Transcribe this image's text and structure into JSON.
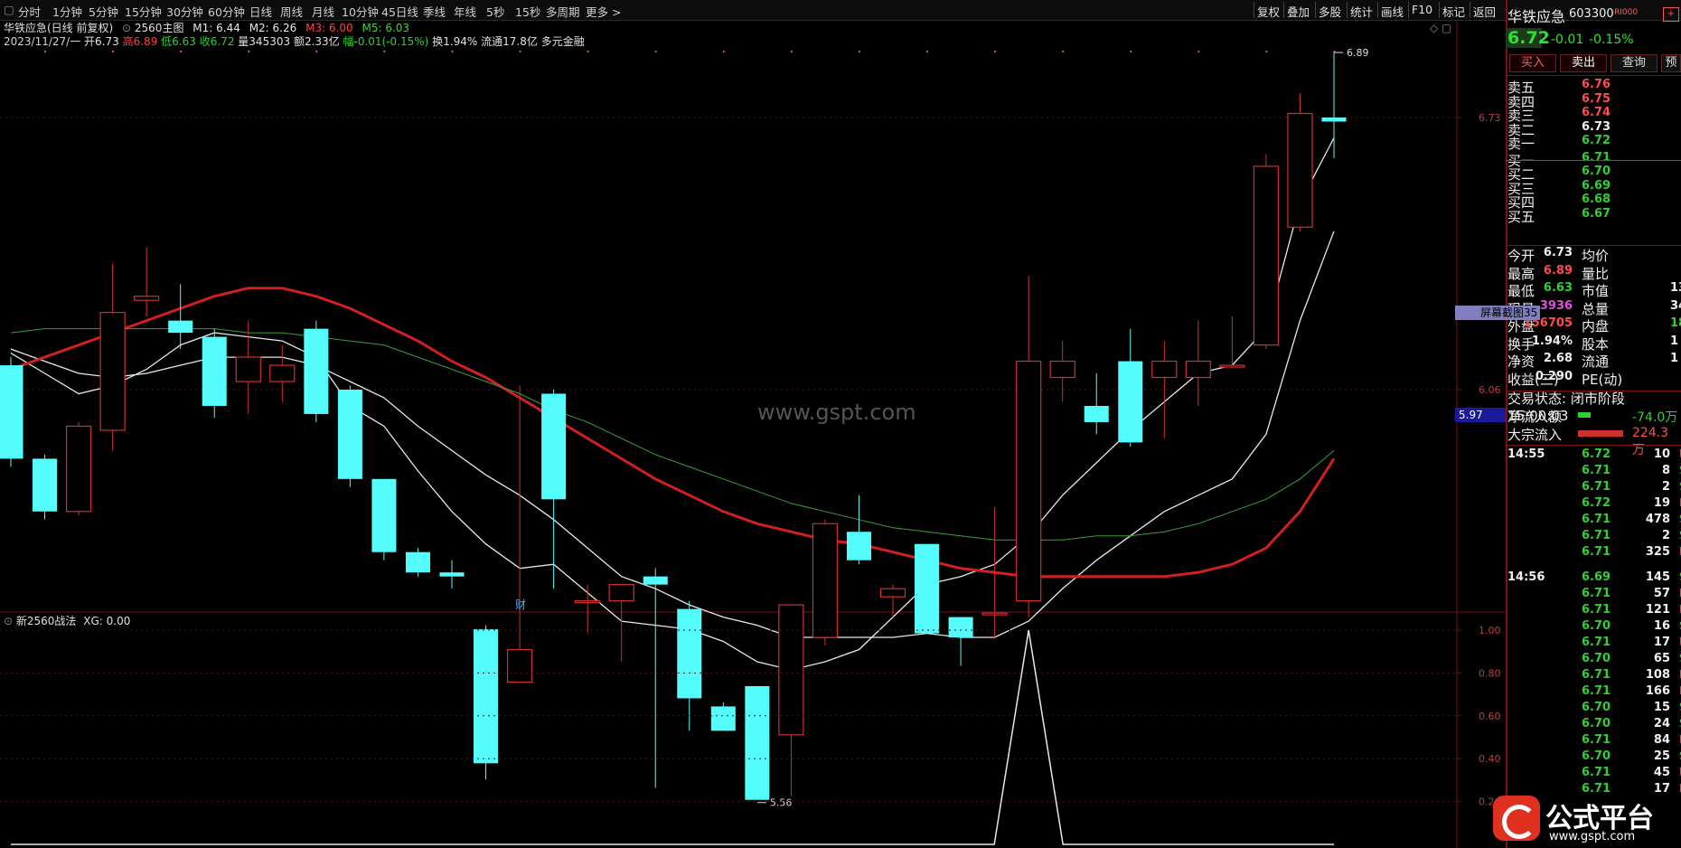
{
  "toolbar": {
    "periods": [
      "分时",
      "1分钟",
      "5分钟",
      "15分钟",
      "30分钟",
      "60分钟",
      "日线",
      "周线",
      "月线",
      "10分钟",
      "45日线",
      "季线",
      "年线",
      "5秒",
      "15秒",
      "多周期",
      "更多 >"
    ],
    "actions": [
      "复权",
      "叠加",
      "多股",
      "统计",
      "画线",
      "F10",
      "标记",
      "返回"
    ]
  },
  "chart_header": {
    "line1": {
      "stock": "华铁应急(日线 前复权)",
      "indicator": "2560主图",
      "m1": "M1: 6.44",
      "m2": "M2: 6.26",
      "m3": "M3: 6.00",
      "m5": "M5: 6.03"
    },
    "line2": {
      "date": "2023/11/27/一",
      "open": "开6.73",
      "high": "高6.89",
      "low": "低6.63",
      "close": "收6.72",
      "volume": "量345303",
      "amount": "额2.33亿",
      "change": "幅-0.01(-0.15%)",
      "turnover": "换1.94%",
      "float": "流通17.8亿",
      "tag": "多元金融"
    },
    "watermark": "www.gspt.com",
    "fin_mark": "财"
  },
  "sub_chart": {
    "title": "新2560战法",
    "value": "XG: 0.00"
  },
  "chart_data": {
    "type": "candlestick",
    "title": "华铁应急(日线 前复权)",
    "candles": [
      {
        "o": 6.12,
        "h": 6.14,
        "l": 5.87,
        "c": 5.89
      },
      {
        "o": 5.89,
        "h": 5.9,
        "l": 5.74,
        "c": 5.76
      },
      {
        "o": 5.76,
        "h": 5.98,
        "l": 5.75,
        "c": 5.97
      },
      {
        "o": 5.96,
        "h": 6.37,
        "l": 5.91,
        "c": 6.25
      },
      {
        "o": 6.28,
        "h": 6.41,
        "l": 6.24,
        "c": 6.29
      },
      {
        "o": 6.23,
        "h": 6.32,
        "l": 6.16,
        "c": 6.2
      },
      {
        "o": 6.19,
        "h": 6.21,
        "l": 5.99,
        "c": 6.02
      },
      {
        "o": 6.08,
        "h": 6.23,
        "l": 6.0,
        "c": 6.14
      },
      {
        "o": 6.08,
        "h": 6.17,
        "l": 6.03,
        "c": 6.12
      },
      {
        "o": 6.21,
        "h": 6.23,
        "l": 5.98,
        "c": 6.0
      },
      {
        "o": 6.06,
        "h": 6.07,
        "l": 5.82,
        "c": 5.84
      },
      {
        "o": 5.84,
        "h": 5.84,
        "l": 5.64,
        "c": 5.66
      },
      {
        "o": 5.66,
        "h": 5.67,
        "l": 5.6,
        "c": 5.61
      },
      {
        "o": 5.61,
        "h": 5.64,
        "l": 5.57,
        "c": 5.6
      },
      {
        "o": 5.47,
        "h": 5.48,
        "l": 5.1,
        "c": 5.14
      },
      {
        "o": 5.34,
        "h": 6.07,
        "l": 5.34,
        "c": 5.42
      },
      {
        "o": 6.05,
        "h": 6.06,
        "l": 5.57,
        "c": 5.79
      },
      {
        "o": 5.54,
        "h": 5.58,
        "l": 5.46,
        "c": 5.54
      },
      {
        "o": 5.54,
        "h": 5.55,
        "l": 5.39,
        "c": 5.58
      },
      {
        "o": 5.6,
        "h": 5.62,
        "l": 5.08,
        "c": 5.58
      },
      {
        "o": 5.52,
        "h": 5.54,
        "l": 5.22,
        "c": 5.3
      },
      {
        "o": 5.28,
        "h": 5.29,
        "l": 5.22,
        "c": 5.22
      },
      {
        "o": 5.33,
        "h": 5.33,
        "l": 5.05,
        "c": 5.05
      },
      {
        "o": 5.21,
        "h": 5.53,
        "l": 5.06,
        "c": 5.53
      },
      {
        "o": 5.45,
        "h": 5.74,
        "l": 5.43,
        "c": 5.73
      },
      {
        "o": 5.71,
        "h": 5.8,
        "l": 5.63,
        "c": 5.64
      },
      {
        "o": 5.55,
        "h": 5.58,
        "l": 5.5,
        "c": 5.57
      },
      {
        "o": 5.68,
        "h": 5.68,
        "l": 5.46,
        "c": 5.46
      },
      {
        "o": 5.5,
        "h": 5.5,
        "l": 5.38,
        "c": 5.45
      },
      {
        "o": 5.51,
        "h": 5.77,
        "l": 5.45,
        "c": 5.51
      },
      {
        "o": 5.54,
        "h": 6.34,
        "l": 5.5,
        "c": 6.13
      },
      {
        "o": 6.09,
        "h": 6.18,
        "l": 6.03,
        "c": 6.13
      },
      {
        "o": 6.02,
        "h": 6.1,
        "l": 5.95,
        "c": 5.98
      },
      {
        "o": 6.13,
        "h": 6.21,
        "l": 5.92,
        "c": 5.93
      },
      {
        "o": 6.09,
        "h": 6.18,
        "l": 5.94,
        "c": 6.13
      },
      {
        "o": 6.09,
        "h": 6.23,
        "l": 6.02,
        "c": 6.13
      },
      {
        "o": 6.12,
        "h": 6.24,
        "l": 6.12,
        "c": 6.12
      },
      {
        "o": 6.17,
        "h": 6.64,
        "l": 6.16,
        "c": 6.61
      },
      {
        "o": 6.46,
        "h": 6.79,
        "l": 6.45,
        "c": 6.74
      },
      {
        "o": 6.73,
        "h": 6.89,
        "l": 6.63,
        "c": 6.72
      }
    ],
    "ma_series": [
      {
        "name": "M1",
        "color": "#e8e8e8",
        "width": 1.3,
        "values": [
          6.15,
          6.1,
          6.05,
          6.07,
          6.11,
          6.17,
          6.2,
          6.19,
          6.18,
          6.14,
          6.02,
          5.97,
          5.86,
          5.76,
          5.68,
          5.62,
          5.63,
          5.56,
          5.49,
          5.48,
          5.47,
          5.44,
          5.39,
          5.37,
          5.39,
          5.42,
          5.5,
          5.58,
          5.6,
          5.63,
          5.7,
          5.8,
          5.88,
          5.96,
          6.03,
          6.1,
          6.12,
          6.21,
          6.52,
          6.68
        ]
      },
      {
        "name": "M2",
        "color": "#e8e8e8",
        "width": 1.3,
        "values": [
          6.16,
          6.13,
          6.1,
          6.09,
          6.1,
          6.12,
          6.14,
          6.14,
          6.14,
          6.12,
          6.08,
          6.04,
          5.97,
          5.91,
          5.85,
          5.8,
          5.74,
          5.67,
          5.6,
          5.57,
          5.53,
          5.5,
          5.48,
          5.45,
          5.45,
          5.45,
          5.45,
          5.46,
          5.45,
          5.45,
          5.49,
          5.57,
          5.64,
          5.7,
          5.76,
          5.8,
          5.84,
          5.95,
          6.23,
          6.45
        ]
      },
      {
        "name": "M3",
        "color": "#d02020",
        "width": 3,
        "values": [
          6.11,
          6.14,
          6.17,
          6.2,
          6.23,
          6.26,
          6.29,
          6.31,
          6.31,
          6.29,
          6.26,
          6.22,
          6.18,
          6.13,
          6.09,
          6.04,
          5.99,
          5.94,
          5.89,
          5.84,
          5.8,
          5.76,
          5.73,
          5.71,
          5.69,
          5.68,
          5.66,
          5.64,
          5.62,
          5.61,
          5.6,
          5.6,
          5.6,
          5.6,
          5.6,
          5.61,
          5.63,
          5.67,
          5.76,
          5.89
        ]
      },
      {
        "name": "M5",
        "color": "#3aa03a",
        "width": 1,
        "values": [
          6.2,
          6.21,
          6.21,
          6.21,
          6.21,
          6.21,
          6.21,
          6.2,
          6.2,
          6.19,
          6.18,
          6.17,
          6.14,
          6.11,
          6.08,
          6.05,
          6.01,
          5.98,
          5.94,
          5.9,
          5.87,
          5.84,
          5.81,
          5.78,
          5.76,
          5.74,
          5.72,
          5.71,
          5.7,
          5.69,
          5.69,
          5.69,
          5.7,
          5.7,
          5.71,
          5.73,
          5.76,
          5.79,
          5.84,
          5.91
        ]
      }
    ],
    "annotations": {
      "high_label": "6.89",
      "low_label": "5.56"
    },
    "ylabels": [
      "6.73",
      "6.06"
    ],
    "current_price_tag": "5.97",
    "sub_values": [
      0,
      0,
      0,
      0,
      0,
      0,
      0,
      0,
      0,
      0,
      0,
      0,
      0,
      0,
      0,
      0,
      0,
      0,
      0,
      0,
      0,
      0,
      0,
      0,
      0,
      0,
      0,
      0,
      0,
      0,
      1,
      0,
      0,
      0,
      0,
      0,
      0,
      0,
      0,
      0
    ],
    "sub_ylabels": [
      "1.00",
      "0.80",
      "0.60",
      "0.40",
      "0.2"
    ],
    "sub_ylim": [
      0,
      1
    ]
  },
  "quote": {
    "name": "华铁应急",
    "code": "603300",
    "badge": "R\u0000",
    "price": "6.72",
    "change": "-0.01",
    "change_pct": "-0.15%",
    "buttons": [
      "买入",
      "卖出",
      "查询",
      "预"
    ],
    "asks": [
      {
        "label": "卖五",
        "price": "6.76",
        "color": "red"
      },
      {
        "label": "卖四",
        "price": "6.75",
        "color": "red"
      },
      {
        "label": "卖三",
        "price": "6.74",
        "color": "red"
      },
      {
        "label": "卖二",
        "price": "6.73",
        "color": "white"
      },
      {
        "label": "卖一",
        "price": "6.72",
        "color": "green"
      }
    ],
    "bids": [
      {
        "label": "买一",
        "price": "6.71",
        "color": "green"
      },
      {
        "label": "买二",
        "price": "6.70",
        "color": "green"
      },
      {
        "label": "买三",
        "price": "6.69",
        "color": "green"
      },
      {
        "label": "买四",
        "price": "6.68",
        "color": "green"
      },
      {
        "label": "买五",
        "price": "6.67",
        "color": "green"
      }
    ],
    "stats": [
      {
        "l1": "今开",
        "v1": "6.73",
        "c1": "white",
        "l2": "均价",
        "v2": "",
        "c2": "white"
      },
      {
        "l1": "最高",
        "v1": "6.89",
        "c1": "red",
        "l2": "量比",
        "v2": "",
        "c2": "white"
      },
      {
        "l1": "最低",
        "v1": "6.63",
        "c1": "green",
        "l2": "市值",
        "v2": "13",
        "c2": "white"
      },
      {
        "l1": "现量",
        "v1": "3936",
        "c1": "mag",
        "l2": "总量",
        "v2": "34",
        "c2": "white"
      },
      {
        "l1": "外盘",
        "v1": "156705",
        "c1": "red",
        "l2": "内盘",
        "v2": "18",
        "c2": "green"
      },
      {
        "l1": "换手",
        "v1": "1.94%",
        "c1": "white",
        "l2": "股本",
        "v2": "1",
        "c2": "white"
      },
      {
        "l1": "净资",
        "v1": "2.68",
        "c1": "white",
        "l2": "流通",
        "v2": "1",
        "c2": "white"
      },
      {
        "l1": "收益(三)",
        "v1": "0.290",
        "c1": "white",
        "l2": "PE(动)",
        "v2": "",
        "c2": "white"
      }
    ],
    "trade_status": "交易状态: 闭市阶段 15:00:03",
    "net_inflow_label": "净流入额",
    "net_inflow": "-74.0万",
    "block_inflow_label": "大宗流入",
    "block_inflow": "224.3万",
    "overlay_tag": "屏幕截图",
    "overlay_num": "35"
  },
  "ticks": [
    {
      "time": "14:55",
      "price": "6.72",
      "vol": "10",
      "dir": "B"
    },
    {
      "time": "",
      "price": "6.71",
      "vol": "8",
      "dir": "S"
    },
    {
      "time": "",
      "price": "6.71",
      "vol": "2",
      "dir": "S"
    },
    {
      "time": "",
      "price": "6.72",
      "vol": "19",
      "dir": "B"
    },
    {
      "time": "",
      "price": "6.71",
      "vol": "478",
      "dir": "S"
    },
    {
      "time": "",
      "price": "6.71",
      "vol": "2",
      "dir": "S"
    },
    {
      "time": "",
      "price": "6.71",
      "vol": "325",
      "dir": "B"
    },
    {
      "time": "14:56",
      "price": "6.69",
      "vol": "145",
      "dir": "S"
    },
    {
      "time": "",
      "price": "6.71",
      "vol": "57",
      "dir": "B"
    },
    {
      "time": "",
      "price": "6.71",
      "vol": "121",
      "dir": "B"
    },
    {
      "time": "",
      "price": "6.70",
      "vol": "16",
      "dir": "S"
    },
    {
      "time": "",
      "price": "6.71",
      "vol": "17",
      "dir": "B"
    },
    {
      "time": "",
      "price": "6.70",
      "vol": "65",
      "dir": "S"
    },
    {
      "time": "",
      "price": "6.71",
      "vol": "108",
      "dir": "B"
    },
    {
      "time": "",
      "price": "6.71",
      "vol": "166",
      "dir": "B"
    },
    {
      "time": "",
      "price": "6.70",
      "vol": "15",
      "dir": "S"
    },
    {
      "time": "",
      "price": "6.70",
      "vol": "24",
      "dir": "S"
    },
    {
      "time": "",
      "price": "6.71",
      "vol": "84",
      "dir": "B"
    },
    {
      "time": "",
      "price": "6.70",
      "vol": "25",
      "dir": "S"
    },
    {
      "time": "",
      "price": "6.71",
      "vol": "45",
      "dir": "B"
    },
    {
      "time": "",
      "price": "6.71",
      "vol": "17",
      "dir": "B"
    }
  ],
  "logo": {
    "title": "公式平台",
    "url": "www.gspt.com"
  },
  "colors": {
    "up": "#d03030",
    "down": "#54fcfc",
    "bg": "#000000",
    "grid": "#7a1010"
  }
}
